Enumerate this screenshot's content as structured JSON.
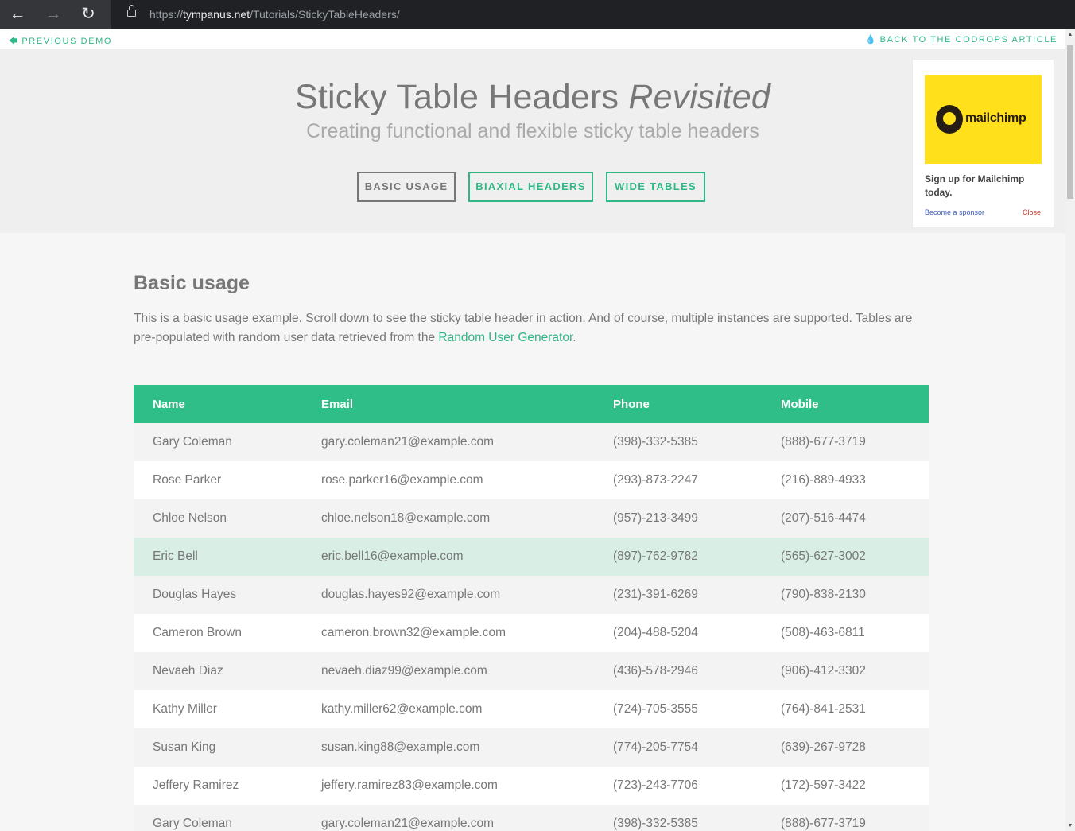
{
  "browser": {
    "url_scheme": "https://",
    "url_host": "tympanus.net",
    "url_path": "/Tutorials/StickyTableHeaders/"
  },
  "topbar": {
    "previous_demo": "Previous Demo",
    "back_to_article": "Back to the Codrops Article"
  },
  "header": {
    "title_main": "Sticky Table Headers",
    "title_em": "Revisited",
    "subtitle": "Creating functional and flexible sticky table headers",
    "demos": [
      "Basic Usage",
      "Biaxial Headers",
      "Wide Tables"
    ]
  },
  "sponsor": {
    "brand": "mailchimp",
    "text": "Sign up for Mailchimp today.",
    "become_sponsor": "Become a sponsor",
    "close": "Close"
  },
  "section": {
    "title": "Basic usage",
    "text_before_link": "This is a basic usage example. Scroll down to see the sticky table header in action. And of course, multiple instances are supported. Tables are pre-populated with random user data retrieved from the ",
    "link": "Random User Generator",
    "text_after_link": "."
  },
  "table": {
    "headers": [
      "Name",
      "Email",
      "Phone",
      "Mobile"
    ],
    "rows": [
      [
        "Gary Coleman",
        "gary.coleman21@example.com",
        "(398)-332-5385",
        "(888)-677-3719"
      ],
      [
        "Rose Parker",
        "rose.parker16@example.com",
        "(293)-873-2247",
        "(216)-889-4933"
      ],
      [
        "Chloe Nelson",
        "chloe.nelson18@example.com",
        "(957)-213-3499",
        "(207)-516-4474"
      ],
      [
        "Eric Bell",
        "eric.bell16@example.com",
        "(897)-762-9782",
        "(565)-627-3002"
      ],
      [
        "Douglas Hayes",
        "douglas.hayes92@example.com",
        "(231)-391-6269",
        "(790)-838-2130"
      ],
      [
        "Cameron Brown",
        "cameron.brown32@example.com",
        "(204)-488-5204",
        "(508)-463-6811"
      ],
      [
        "Nevaeh Diaz",
        "nevaeh.diaz99@example.com",
        "(436)-578-2946",
        "(906)-412-3302"
      ],
      [
        "Kathy Miller",
        "kathy.miller62@example.com",
        "(724)-705-3555",
        "(764)-841-2531"
      ],
      [
        "Susan King",
        "susan.king88@example.com",
        "(774)-205-7754",
        "(639)-267-9728"
      ],
      [
        "Jeffery Ramirez",
        "jeffery.ramirez83@example.com",
        "(723)-243-7706",
        "(172)-597-3422"
      ],
      [
        "Gary Coleman",
        "gary.coleman21@example.com",
        "(398)-332-5385",
        "(888)-677-3719"
      ]
    ]
  },
  "colors": {
    "accent": "#2fbe88",
    "highlight_row": "#d9efe6"
  }
}
